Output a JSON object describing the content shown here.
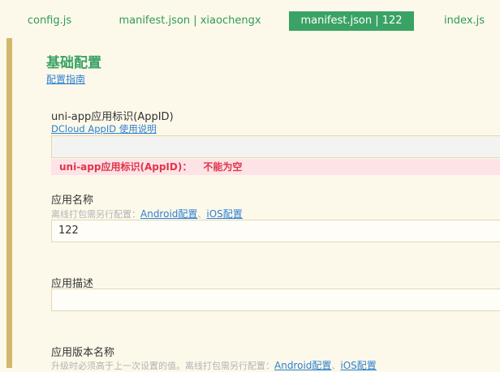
{
  "tabs": [
    {
      "label": "config.js",
      "active": false
    },
    {
      "label": "manifest.json | xiaochengx",
      "active": false
    },
    {
      "label": "manifest.json | 122",
      "active": true
    },
    {
      "label": "index.js",
      "active": false
    }
  ],
  "section": {
    "title": "基础配置",
    "guide_link": "配置指南"
  },
  "appid": {
    "label": "uni-app应用标识(AppID)",
    "help_link": "DCloud AppID 使用说明",
    "value": "",
    "error_label": "uni-app应用标识(AppID)：",
    "error_msg": "不能为空"
  },
  "app_name": {
    "label": "应用名称",
    "hint_prefix": "离线打包需另行配置：",
    "android_link": "Android配置",
    "sep": "、",
    "ios_link": "iOS配置",
    "value": "122"
  },
  "app_desc": {
    "label": "应用描述",
    "value": ""
  },
  "app_version_name": {
    "label": "应用版本名称",
    "hint_prefix": "升级时必须高于上一次设置的值。离线打包需另行配置：",
    "android_link": "Android配置",
    "sep": "、",
    "ios_link": "iOS配置"
  },
  "colors": {
    "accent": "#3aa264",
    "sidebar": "#d2b86a",
    "link": "#2d7fd3",
    "error": "#e0354a",
    "background": "#fdf9ea"
  }
}
